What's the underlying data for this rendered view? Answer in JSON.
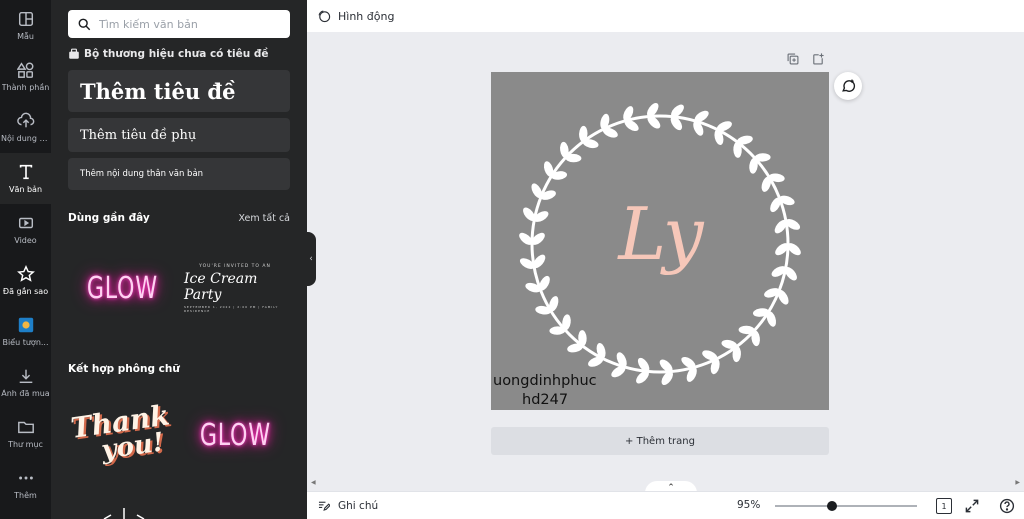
{
  "rail": [
    {
      "label": "Mẫu",
      "icon": "template-icon"
    },
    {
      "label": "Thành phần",
      "icon": "elements-icon"
    },
    {
      "label": "Nội dung t...",
      "icon": "upload-icon"
    },
    {
      "label": "Văn bản",
      "icon": "text-icon"
    },
    {
      "label": "Video",
      "icon": "video-icon"
    },
    {
      "label": "Đã gắn sao",
      "icon": "star-icon"
    },
    {
      "label": "Biểu tượn...",
      "icon": "logo-icon"
    },
    {
      "label": "Ảnh đã mua",
      "icon": "download-icon"
    },
    {
      "label": "Thư mục",
      "icon": "folder-icon"
    },
    {
      "label": "Thêm",
      "icon": "more-icon"
    }
  ],
  "panel": {
    "search_placeholder": "Tìm kiếm văn bản",
    "brand_title": "Bộ thương hiệu chưa có tiêu đề",
    "heading": "Thêm tiêu đề",
    "subheading": "Thêm tiêu đề phụ",
    "body": "Thêm nội dung thân văn bản",
    "recent_title": "Dùng gần đây",
    "see_all": "Xem tất cả",
    "recent": {
      "glow": "GLOW",
      "invite_top": "YOU'RE INVITED TO AN",
      "invite_main": "Ice Cream Party",
      "invite_bottom": "SEPTEMBER 1, 2022 | 2:00 PM | FAMILY RESIDENCE"
    },
    "combos_title": "Kết hợp phông chữ",
    "combos": {
      "thank_1": "Thank",
      "thank_2": "you!",
      "glow": "GLOW"
    }
  },
  "topbar": {
    "animate": "Hình động"
  },
  "canvas": {
    "monogram": "Ly",
    "watermark_line1": "uongdinhphuc",
    "watermark_line2": "hd247",
    "add_page": "+ Thêm trang"
  },
  "bottombar": {
    "notes": "Ghi chú",
    "zoom": "95%",
    "zoom_level": 0.95,
    "page_count": "1"
  },
  "colors": {
    "rail_bg": "#18191b",
    "panel_bg": "#252627",
    "design_bg": "#8a8a8a",
    "monogram": "#f6c7b9"
  }
}
